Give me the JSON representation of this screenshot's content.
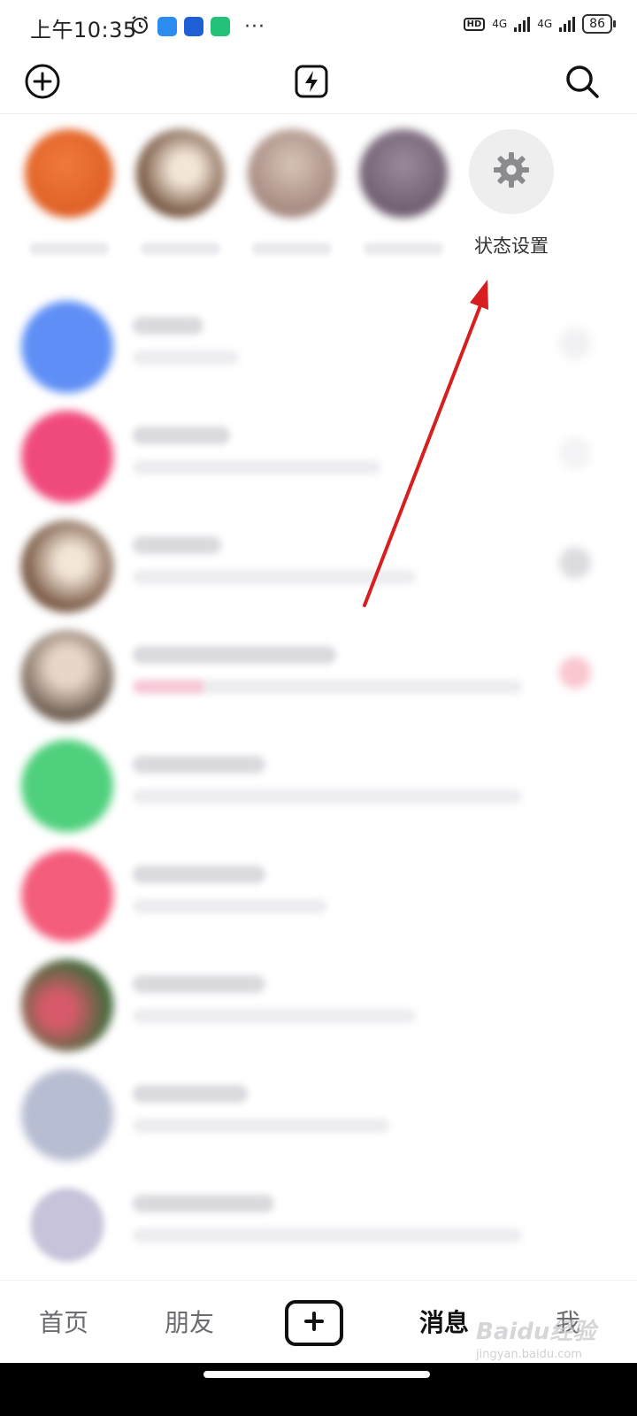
{
  "status_bar": {
    "time": "上午10:35",
    "hd": "HD",
    "net1": "4G",
    "net2": "4G",
    "battery": "86",
    "more": "···"
  },
  "top_nav": {
    "add_icon": "plus-circle-icon",
    "flash_icon": "lightning-icon",
    "search_icon": "search-icon"
  },
  "status_setting": {
    "label": "状态设置"
  },
  "tabs": [
    {
      "label": "首页"
    },
    {
      "label": "朋友"
    },
    {
      "label": "消息"
    },
    {
      "label": "我"
    }
  ],
  "watermark": {
    "brand": "Baidu经验",
    "url": "jingyan.baidu.com"
  },
  "colors": {
    "accent": "#111111",
    "annotation_arrow": "#d71f1f",
    "inactive_tab": "#6b6b70"
  }
}
